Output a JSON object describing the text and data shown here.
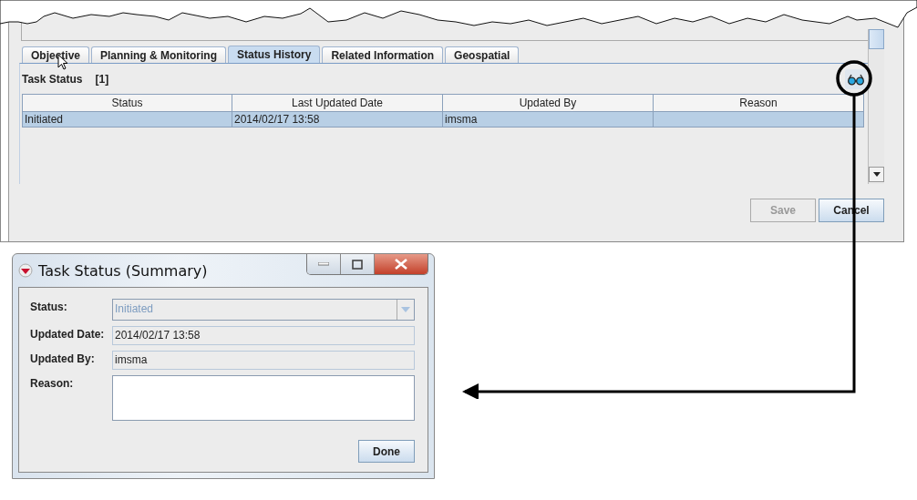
{
  "tabs": [
    {
      "label": "Objective",
      "selected": false
    },
    {
      "label": "Planning & Monitoring",
      "selected": false
    },
    {
      "label": "Status History",
      "selected": true
    },
    {
      "label": "Related Information",
      "selected": false
    },
    {
      "label": "Geospatial",
      "selected": false
    }
  ],
  "section": {
    "title": "Task Status",
    "count": "[1]"
  },
  "table": {
    "columns": [
      "Status",
      "Last Updated Date",
      "Updated By",
      "Reason"
    ],
    "rows": [
      {
        "cells": [
          "Initiated",
          "2014/02/17 13:58",
          "imsma",
          ""
        ],
        "selected": true
      }
    ]
  },
  "buttons": [
    {
      "label": "Save",
      "disabled": true
    },
    {
      "label": "Cancel",
      "disabled": false
    }
  ],
  "dialog": {
    "title": "Task Status (Summary)",
    "fields": [
      {
        "kind": "select",
        "label": "Status:",
        "value": "Initiated",
        "disabled": true
      },
      {
        "kind": "text",
        "label": "Updated Date:",
        "value": "2014/02/17 13:58",
        "disabled": false
      },
      {
        "kind": "text",
        "label": "Updated By:",
        "value": "imsma",
        "disabled": false
      },
      {
        "kind": "textarea",
        "label": "Reason:",
        "disabled": false
      }
    ],
    "button": "Done"
  }
}
